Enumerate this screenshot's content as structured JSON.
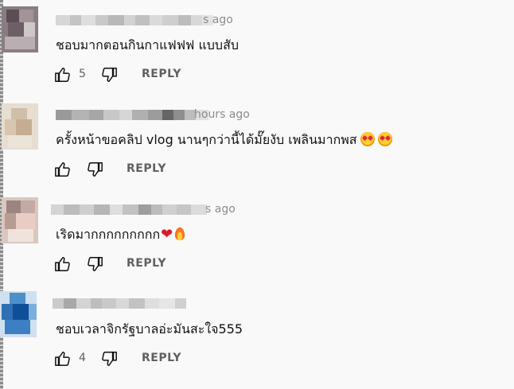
{
  "comments": [
    {
      "time": "s ago",
      "text": "ชอบมากตอนกินกาแฟฟฟ แบบสับ",
      "likes": "5",
      "reply_label": "REPLY"
    },
    {
      "time": "hours ago",
      "text": "ครั้งหน้าขอคลิป vlog นานๆกว่านี้ได้มั๊ยงับ เพลินมากพส",
      "likes": "",
      "reply_label": "REPLY",
      "emojis": [
        "heart-eyes-emoji",
        "heart-eyes-emoji"
      ]
    },
    {
      "time": "s ago",
      "text": "เริดมากกกกกกกกก",
      "likes": "",
      "reply_label": "REPLY",
      "emojis": [
        "red-heart-emoji",
        "fire-emoji"
      ]
    },
    {
      "time": "",
      "text": "ชอบเวลาจิกรัฐบาลอ่ะมันสะใจ555",
      "likes": "4",
      "reply_label": "REPLY"
    }
  ],
  "colors": {
    "background": "#f9f9f9",
    "text": "#111111",
    "muted": "#606060",
    "timestamp": "#8c8c8c"
  }
}
